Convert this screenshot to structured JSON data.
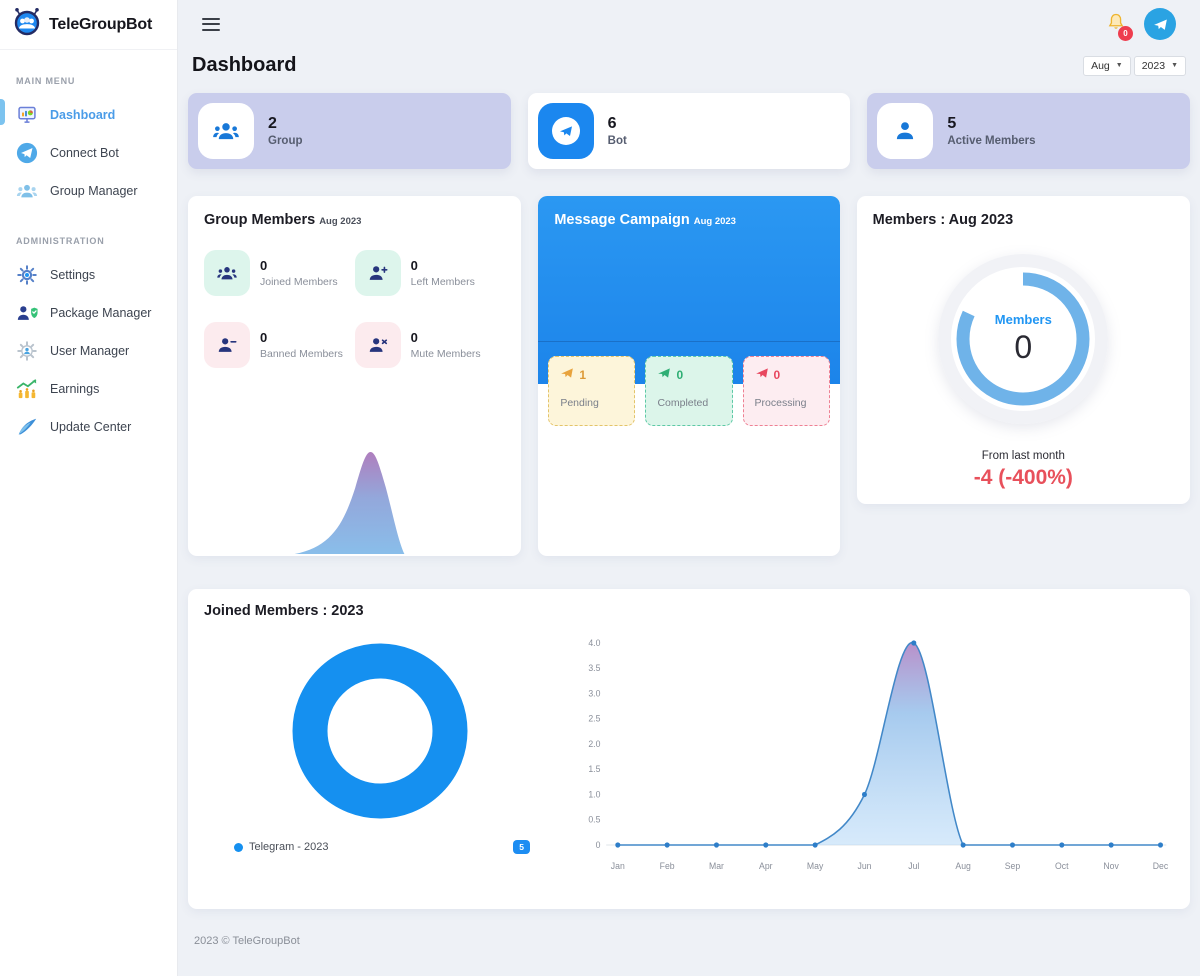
{
  "brand": {
    "name": "TeleGroupBot"
  },
  "sidebar": {
    "main_menu_label": "MAIN MENU",
    "admin_label": "ADMINISTRATION",
    "main_items": [
      {
        "label": "Dashboard"
      },
      {
        "label": "Connect Bot"
      },
      {
        "label": "Group Manager"
      }
    ],
    "admin_items": [
      {
        "label": "Settings"
      },
      {
        "label": "Package Manager"
      },
      {
        "label": "User Manager"
      },
      {
        "label": "Earnings"
      },
      {
        "label": "Update Center"
      }
    ]
  },
  "topbar": {
    "notification_count": "0"
  },
  "header": {
    "title": "Dashboard",
    "month_select": "Aug",
    "year_select": "2023"
  },
  "stats": [
    {
      "value": "2",
      "label": "Group"
    },
    {
      "value": "6",
      "label": "Bot"
    },
    {
      "value": "5",
      "label": "Active Members"
    }
  ],
  "group_members": {
    "title": "Group Members",
    "period": "Aug 2023",
    "items": [
      {
        "value": "0",
        "label": "Joined Members"
      },
      {
        "value": "0",
        "label": "Left Members"
      },
      {
        "value": "0",
        "label": "Banned Members"
      },
      {
        "value": "0",
        "label": "Mute Members"
      }
    ]
  },
  "campaign": {
    "title": "Message Campaign",
    "period": "Aug 2023",
    "boxes": [
      {
        "value": "1",
        "label": "Pending"
      },
      {
        "value": "0",
        "label": "Completed"
      },
      {
        "value": "0",
        "label": "Processing"
      }
    ]
  },
  "members_card": {
    "title": "Members : Aug 2023",
    "gauge_label": "Members",
    "gauge_value": "0",
    "footnote": "From last month",
    "delta": "-4 (-400%)"
  },
  "joined_card": {
    "title": "Joined Members : 2023",
    "legend": "Telegram - 2023",
    "badge": "5"
  },
  "footer": {
    "copyright": "2023 © TeleGroupBot"
  },
  "colors": {
    "accent": "#1e88f0",
    "lavender": "#c9cdec",
    "negative": "#e8505b",
    "pending": "#dd9a36",
    "completed": "#2fae74",
    "processing": "#e8475f",
    "donut_blue": "#1590f0",
    "gauge_blue": "#6fb3e9"
  },
  "chart_data": [
    {
      "type": "pie",
      "donut": true,
      "title": "Joined Members : 2023",
      "labels": [
        "Telegram - 2023"
      ],
      "values": [
        5
      ],
      "colors": [
        "#1590f0"
      ],
      "legend_position": "bottom"
    },
    {
      "type": "line",
      "area": true,
      "title": "Joined Members : 2023 (monthly)",
      "x": [
        "Jan",
        "Feb",
        "Mar",
        "Apr",
        "May",
        "Jun",
        "Jul",
        "Aug",
        "Sep",
        "Oct",
        "Nov",
        "Dec"
      ],
      "series": [
        {
          "name": "Joined Members",
          "values": [
            0,
            0,
            0,
            0,
            0,
            1,
            4,
            0,
            0,
            0,
            0,
            0
          ]
        }
      ],
      "ylim": [
        0,
        4
      ],
      "yticks": [
        "4.0",
        "3.5",
        "3.0",
        "2.5",
        "2.0",
        "1.5",
        "1.0",
        "0.5",
        "0"
      ],
      "grid": false,
      "legend_position": "none"
    }
  ]
}
